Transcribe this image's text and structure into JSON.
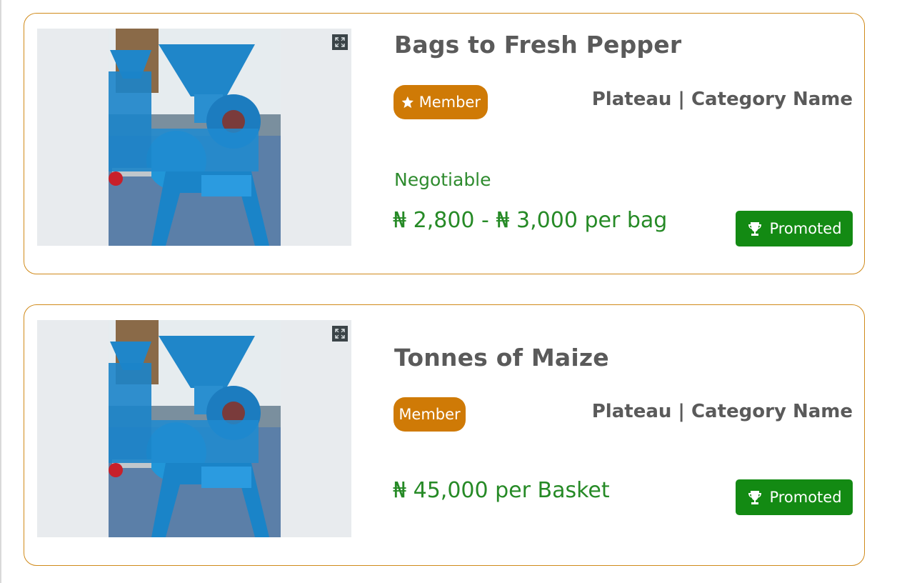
{
  "currency_symbol": "₦",
  "colors": {
    "card_border": "#d08a1a",
    "member_badge": "#cf7a06",
    "promoted_button": "#138a13",
    "price_text": "#268a26",
    "title_text": "#5a5a5a"
  },
  "listings": [
    {
      "title": "Bags to Fresh Pepper",
      "member_label": "Member",
      "member_icon": "star-icon",
      "location": "Plateau | Category Name",
      "negotiable": "Negotiable",
      "price": "₦ 2,800 - ₦ 3,000 per bag",
      "promoted_label": "Promoted",
      "promoted_icon": "trophy-icon",
      "image_icon": "expand-icon"
    },
    {
      "title": "Tonnes of Maize",
      "member_label": "Member",
      "location": "Plateau | Category Name",
      "price": "₦ 45,000 per Basket",
      "promoted_label": "Promoted",
      "promoted_icon": "trophy-icon",
      "image_icon": "expand-icon"
    }
  ]
}
